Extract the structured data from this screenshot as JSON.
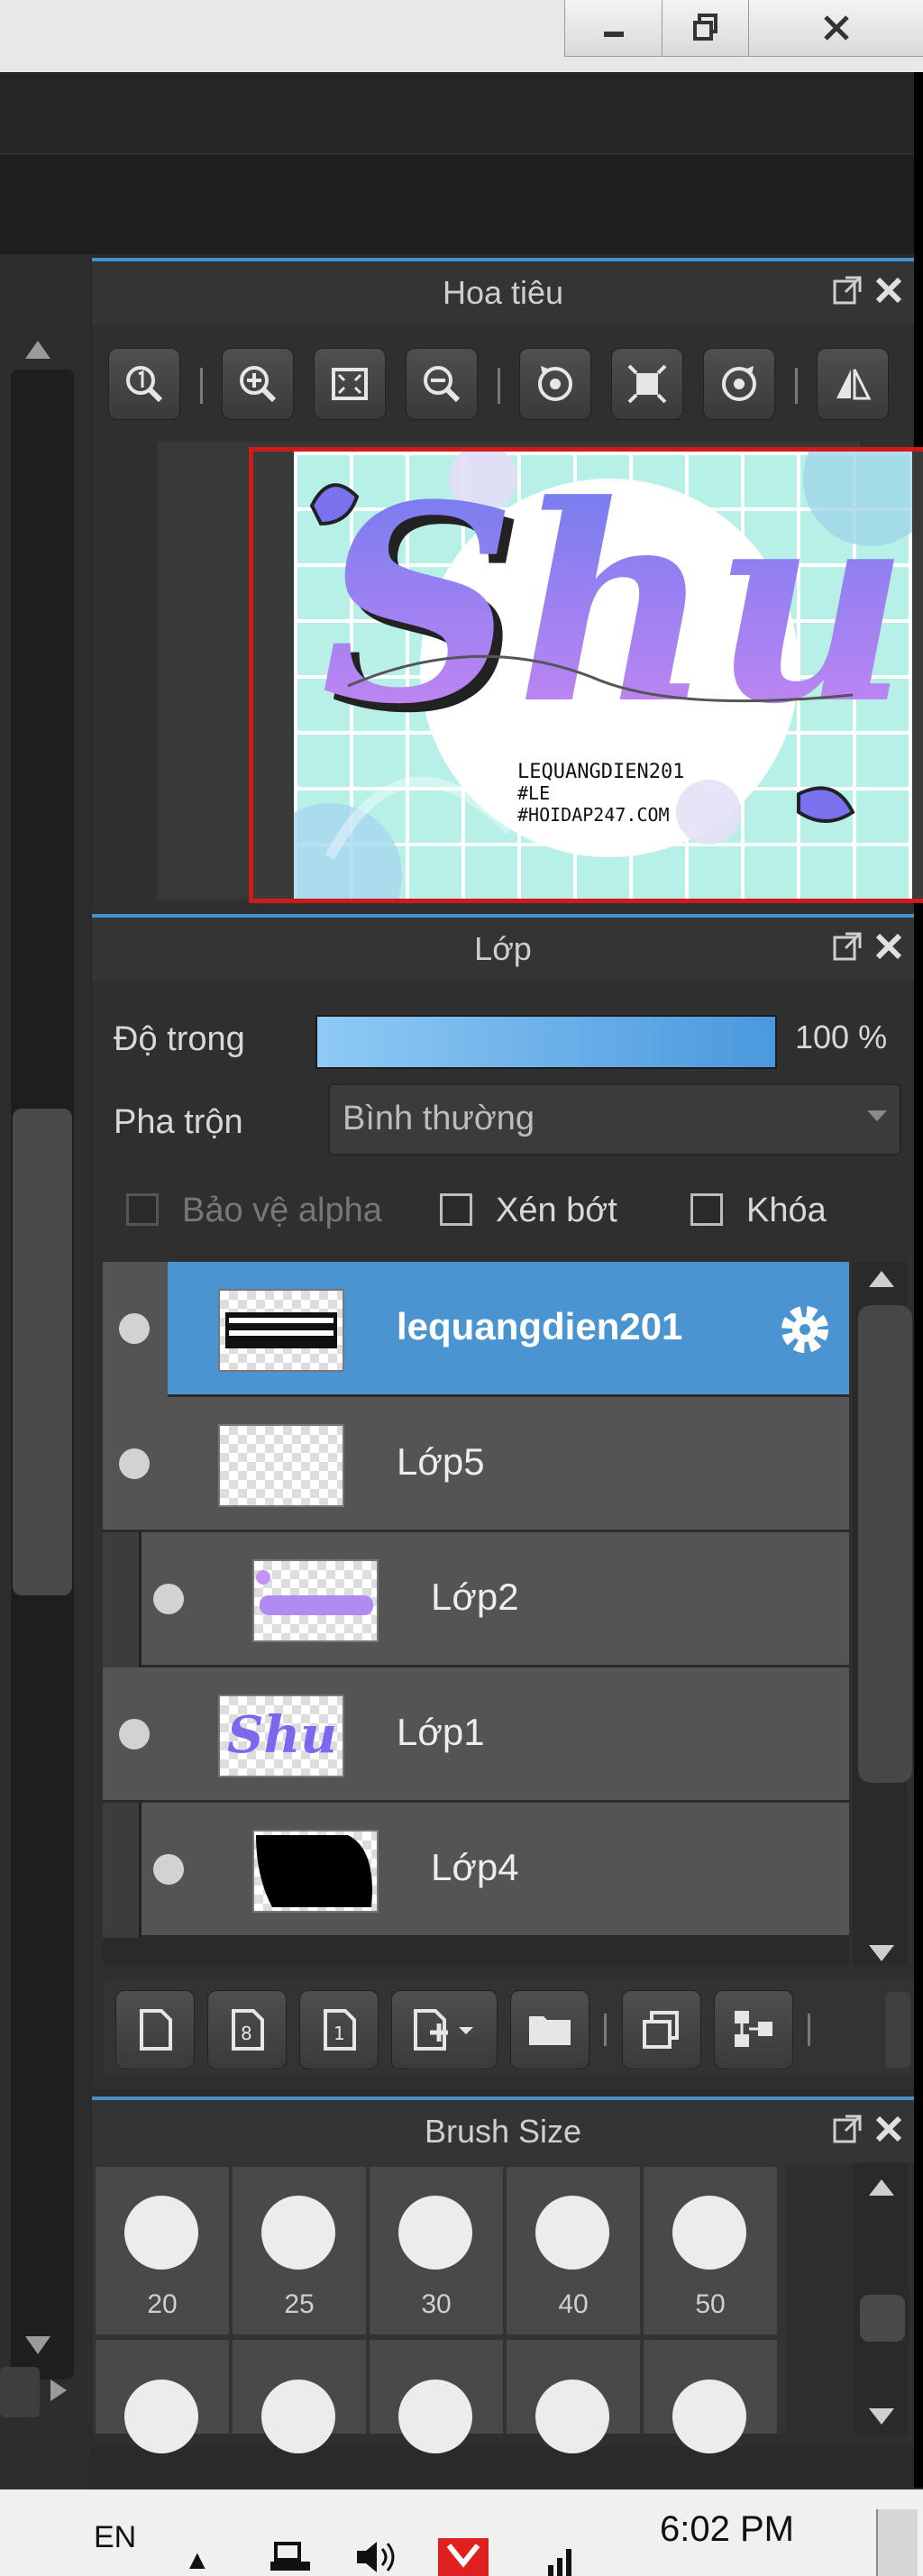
{
  "navigator": {
    "title": "Hoa tiêu",
    "artwork_text": {
      "main": "Shu",
      "credit_line1": "LEQUANGDIEN201",
      "credit_line2": "#LE",
      "credit_line3": "#HOIDAP247.COM"
    }
  },
  "layers_panel": {
    "title": "Lớp",
    "opacity_label": "Độ trong",
    "opacity_value": "100 %",
    "opacity_fraction": 1.0,
    "blend_label": "Pha trộn",
    "blend_value": "Bình thường",
    "checkboxes": {
      "protect_alpha": "Bảo vệ alpha",
      "clipping": "Xén bớt",
      "lock": "Khóa"
    },
    "layers": [
      {
        "name": "lequangdien201",
        "selected": true,
        "clipped": false
      },
      {
        "name": "Lớp5",
        "selected": false,
        "clipped": false
      },
      {
        "name": "Lớp2",
        "selected": false,
        "clipped": true
      },
      {
        "name": "Lớp1",
        "selected": false,
        "clipped": false
      },
      {
        "name": "Lớp4",
        "selected": false,
        "clipped": true
      }
    ]
  },
  "brush_panel": {
    "title": "Brush Size",
    "sizes": [
      "20",
      "25",
      "30",
      "40",
      "50"
    ]
  },
  "taskbar": {
    "language": "EN",
    "time": "6:02 PM"
  },
  "colors": {
    "accent": "#4a95d1",
    "selected_layer": "#4a95d1",
    "preview_border": "#d11a1a"
  }
}
